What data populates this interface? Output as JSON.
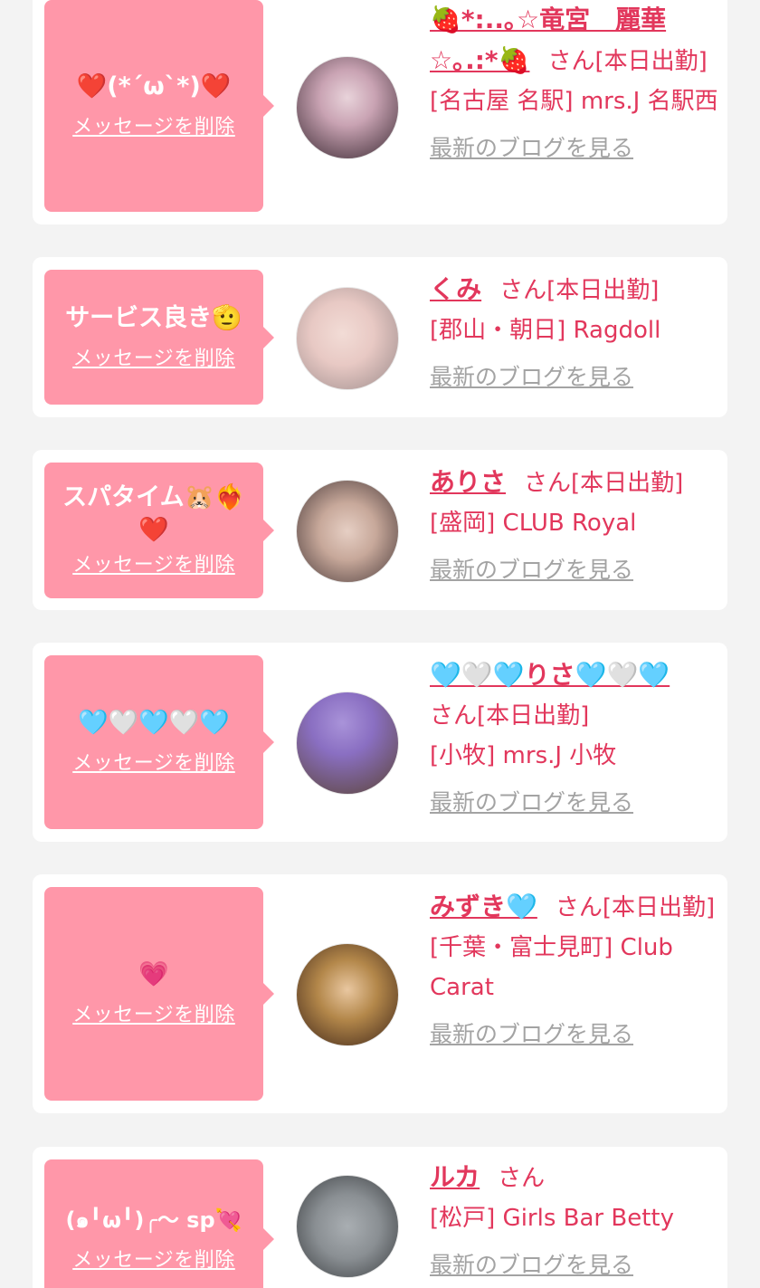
{
  "favorites": [
    {
      "message": "❤️(*´ω`*)❤️",
      "delete_label": "メッセージを削除",
      "name": "🍓*:..｡☆竜宮　麗華☆｡.:*🍓",
      "san": "さん",
      "status": "[本日出勤]",
      "shop": "[名古屋 名駅] mrs.J 名駅西",
      "blog_label": "最新のブログを見る",
      "avatar_colors": [
        "#c9a3b3",
        "#3b2a33"
      ]
    },
    {
      "message": "サービス良き🫡",
      "delete_label": "メッセージを削除",
      "name": "くみ",
      "san": "さん",
      "status": "[本日出勤]",
      "shop": "[郡山・朝日] Ragdoll",
      "blog_label": "最新のブログを見る",
      "avatar_colors": [
        "#e8c9c4",
        "#9a8a8a"
      ]
    },
    {
      "message": "スパタイム🐹❤️‍🔥❤️",
      "delete_label": "メッセージを削除",
      "name": "ありさ",
      "san": "さん",
      "status": "[本日出勤]",
      "shop": "[盛岡] CLUB Royal",
      "blog_label": "最新のブログを見る",
      "avatar_colors": [
        "#c7a89a",
        "#4a3a3a"
      ]
    },
    {
      "message": "🩵🤍🩵🤍🩵",
      "delete_label": "メッセージを削除",
      "name": "🩵🤍🩵りさ🩵🤍🩵",
      "san": "さん",
      "status": "[本日出勤]",
      "shop": "[小牧] mrs.J 小牧",
      "blog_label": "最新のブログを見る",
      "avatar_colors": [
        "#8a6fc2",
        "#5c4536"
      ]
    },
    {
      "message": "💗",
      "delete_label": "メッセージを削除",
      "name": "みずき🩵",
      "san": "さん",
      "status": "[本日出勤]",
      "shop": "[千葉・富士見町] Club Carat",
      "blog_label": "最新のブログを見る",
      "avatar_colors": [
        "#b3874a",
        "#3d2418"
      ]
    },
    {
      "message": "(๑╹ω╹)╭〜 sp💘",
      "delete_label": "メッセージを削除",
      "name": "ルカ",
      "san": "さん",
      "status": "",
      "shop": "[松戸] Girls Bar Betty",
      "blog_label": "最新のブログを見る",
      "avatar_colors": [
        "#8a8f93",
        "#3a3d40"
      ]
    }
  ],
  "colors": {
    "accent": "#e2375c",
    "bubble": "#ff97a9",
    "link_gray": "#a3a3a3",
    "background": "#f3f3f3"
  }
}
